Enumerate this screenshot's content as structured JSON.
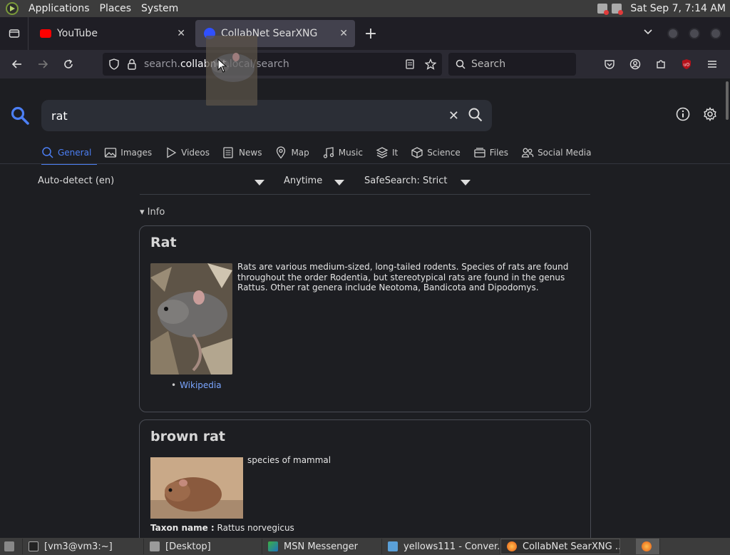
{
  "gnome_panel": {
    "menus": [
      "Applications",
      "Places",
      "System"
    ],
    "datetime": "Sat Sep  7, 7:14 AM"
  },
  "tabs": [
    {
      "label": "YouTube",
      "favicon_color": "#ff0000"
    },
    {
      "label": "CollabNet SearXNG",
      "favicon_color": "#3050ff"
    }
  ],
  "urlbar": {
    "prefix": "search.",
    "host": "collabnet",
    "suffix": ".local/search"
  },
  "searchbar": {
    "placeholder": "Search"
  },
  "search": {
    "query": "rat",
    "categories": [
      "General",
      "Images",
      "Videos",
      "News",
      "Map",
      "Music",
      "It",
      "Science",
      "Files",
      "Social Media"
    ],
    "active_category": "General",
    "language": "Auto-detect (en)",
    "time_range": "Anytime",
    "safesearch": "SafeSearch: Strict",
    "info_toggle": "Info"
  },
  "infobox": {
    "title": "Rat",
    "text": "Rats are various medium-sized, long-tailed rodents. Species of rats are found throughout the order Rodentia, but stereotypical rats are found in the genus Rattus. Other rat genera include Neotoma, Bandicota and Dipodomys.",
    "link": "Wikipedia"
  },
  "infobox2": {
    "title": "brown rat",
    "text": "species of mammal",
    "taxon_label": "Taxon name :",
    "taxon_value": "Rattus norvegicus"
  },
  "taskbar": [
    {
      "label": "[vm3@vm3:~]"
    },
    {
      "label": "[Desktop]"
    },
    {
      "label": "MSN Messenger"
    },
    {
      "label": "yellows111 - Conver..."
    },
    {
      "label": "CollabNet SearXNG ..."
    }
  ],
  "colors": {
    "accent": "#4c7ff4",
    "link": "#7aa5ff",
    "panel": "#3c3c3c"
  }
}
